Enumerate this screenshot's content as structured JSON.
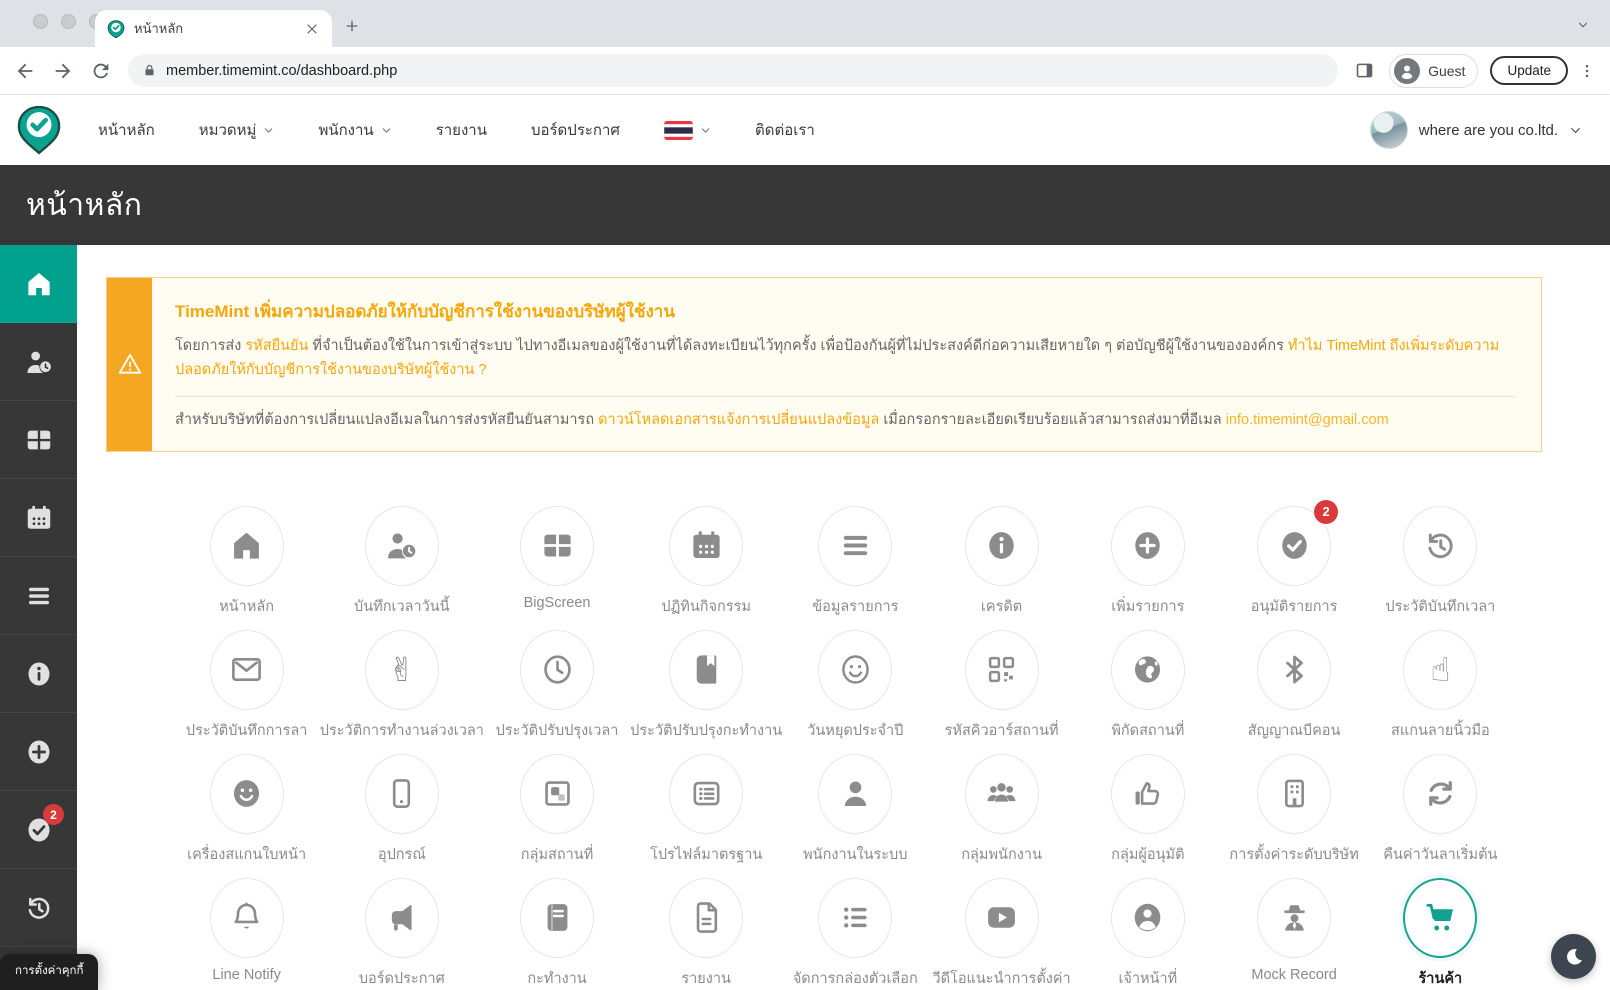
{
  "browser": {
    "tab_title": "หน้าหลัก",
    "url": "member.timemint.co/dashboard.php",
    "guest_label": "Guest",
    "update_label": "Update"
  },
  "navbar": {
    "items": [
      {
        "label": "หน้าหลัก",
        "chevron": false
      },
      {
        "label": "หมวดหมู่",
        "chevron": true
      },
      {
        "label": "พนักงาน",
        "chevron": true
      },
      {
        "label": "รายงาน",
        "chevron": false
      },
      {
        "label": "บอร์ดประกาศ",
        "chevron": false
      }
    ],
    "language_flag": "thai-flag",
    "contact_label": "ติดต่อเรา",
    "company": "where are you co.ltd."
  },
  "page": {
    "title": "หน้าหลัก"
  },
  "sidebar": {
    "items": [
      {
        "icon": "home",
        "active": true
      },
      {
        "icon": "user-clock"
      },
      {
        "icon": "grid"
      },
      {
        "icon": "calendar"
      },
      {
        "icon": "menu"
      },
      {
        "icon": "info-filled"
      },
      {
        "icon": "plus-filled"
      },
      {
        "icon": "check-filled",
        "badge": "2"
      },
      {
        "icon": "history"
      }
    ],
    "cookie_label": "การตั้งค่าคุกกี้"
  },
  "alert": {
    "title": "TimeMint เพิ่มความปลอดภัยให้กับบัญชีการใช้งานของบริษัทผู้ใช้งาน",
    "p1": [
      {
        "t": "โดยการส่ง "
      },
      {
        "t": "รหัสยืนยัน",
        "c": "accent"
      },
      {
        "t": " ที่จำเป็นต้องใช้ในการเข้าสู่ระบบ ไปทางอีเมลของผู้ใช้งานที่ได้ลงทะเบียนไว้ทุกครั้ง เพื่อป้องกันผู้ที่ไม่ประสงค์ดีก่อความเสียหายใด ๆ ต่อบัญชีผู้ใช้งานขององค์กร "
      },
      {
        "t": "ทำไม TimeMint ถึงเพิ่มระดับความปลอดภัยให้กับบัญชีการใช้งานของบริษัทผู้ใช้งาน ?",
        "c": "accent"
      }
    ],
    "p2": [
      {
        "t": "สำหรับบริษัทที่ต้องการเปลี่ยนแปลงอีเมลในการส่งรหัสยืนยันสามารถ "
      },
      {
        "t": "ดาวน์โหลดเอกสารแจ้งการเปลี่ยนแปลงข้อมูล",
        "c": "accent"
      },
      {
        "t": " เมื่อกรอกรายละเอียดเรียบร้อยแล้วสามารถส่งมาที่อีเมล "
      },
      {
        "t": "info.timemint@gmail.com",
        "c": "accent2"
      }
    ]
  },
  "grid": {
    "items": [
      {
        "icon": "home",
        "label": "หน้าหลัก"
      },
      {
        "icon": "user-clock",
        "label": "บันทึกเวลาวันนี้"
      },
      {
        "icon": "grid",
        "label": "BigScreen"
      },
      {
        "icon": "calendar",
        "label": "ปฏิทินกิจกรรม"
      },
      {
        "icon": "menu",
        "label": "ข้อมูลรายการ"
      },
      {
        "icon": "info-filled",
        "label": "เครดิต"
      },
      {
        "icon": "plus-filled",
        "label": "เพิ่มรายการ"
      },
      {
        "icon": "check-filled",
        "label": "อนุมัติรายการ",
        "badge": "2"
      },
      {
        "icon": "history",
        "label": "ประวัติบันทึกเวลา"
      },
      {
        "icon": "envelope",
        "label": "ประวัติบันทึกการลา"
      },
      {
        "icon": "victory-hand",
        "label": "ประวัติการทำงานล่วงเวลา"
      },
      {
        "icon": "clock",
        "label": "ประวัติปรับปรุงเวลา"
      },
      {
        "icon": "book",
        "label": "ประวัติปรับปรุงกะทำงาน"
      },
      {
        "icon": "smile",
        "label": "วันหยุดประจำปี"
      },
      {
        "icon": "qr-code",
        "label": "รหัสคิวอาร์สถานที่"
      },
      {
        "icon": "globe",
        "label": "พิกัดสถานที่"
      },
      {
        "icon": "bluetooth",
        "label": "สัญญาณบีคอน"
      },
      {
        "icon": "point-hand",
        "label": "สแกนลายนิ้วมือ"
      },
      {
        "icon": "smile-filled",
        "label": "เครื่องสแกนใบหน้า"
      },
      {
        "icon": "phone",
        "label": "อุปกรณ์"
      },
      {
        "icon": "frame",
        "label": "กลุ่มสถานที่"
      },
      {
        "icon": "profile-card",
        "label": "โปรไฟล์มาตรฐาน"
      },
      {
        "icon": "person",
        "label": "พนักงานในระบบ"
      },
      {
        "icon": "people",
        "label": "กลุ่มพนักงาน"
      },
      {
        "icon": "thumb-up",
        "label": "กลุ่มผู้อนุมัติ"
      },
      {
        "icon": "building",
        "label": "การตั้งค่าระดับบริษัท"
      },
      {
        "icon": "refresh",
        "label": "คืนค่าวันลาเริ่มต้น"
      },
      {
        "icon": "bell",
        "label": "Line Notify"
      },
      {
        "icon": "megaphone",
        "label": "บอร์ดประกาศ"
      },
      {
        "icon": "journal",
        "label": "กะทำงาน"
      },
      {
        "icon": "file-doc",
        "label": "รายงาน"
      },
      {
        "icon": "list-ul",
        "label": "จัดการกล่องตัวเลือก"
      },
      {
        "icon": "play",
        "label": "วีดีโอแนะนำการตั้งค่า"
      },
      {
        "icon": "person-circle",
        "label": "เจ้าหน้าที่"
      },
      {
        "icon": "spy",
        "label": "Mock Record"
      },
      {
        "icon": "cart",
        "label": "ร้านค้า",
        "accent": true
      }
    ]
  },
  "colors": {
    "teal": "#00a28e",
    "dark": "#373737",
    "alert_orange": "#f5a623",
    "badge_red": "#d93a3a",
    "icon_gray": "#8c8c8c"
  }
}
